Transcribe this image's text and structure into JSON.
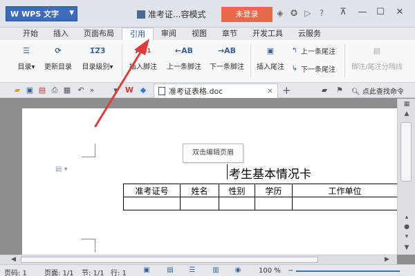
{
  "titlebar": {
    "app_logo": "W",
    "app_name": "WPS 文字",
    "doc_title": "准考证...容模式",
    "login": "未登录",
    "icons": [
      "skin-icon",
      "settings-icon",
      "share-icon",
      "help-icon"
    ],
    "help_glyph": "?",
    "restore_glyph": "⊼",
    "minimize_glyph": "—",
    "maximize_glyph": "☐",
    "close_glyph": "✕"
  },
  "tabs": [
    {
      "label": "开始"
    },
    {
      "label": "插入"
    },
    {
      "label": "页面布局"
    },
    {
      "label": "引用",
      "active": true
    },
    {
      "label": "审阅"
    },
    {
      "label": "视图"
    },
    {
      "label": "章节"
    },
    {
      "label": "开发工具"
    },
    {
      "label": "云服务"
    }
  ],
  "ribbon": {
    "toc": "目录",
    "update_toc": "更新目录",
    "toc_level": "目录级别",
    "insert_footnote": "插入脚注",
    "prev_footnote": "上一条脚注",
    "next_footnote": "下一条脚注",
    "insert_endnote": "插入尾注",
    "prev_endnote": "上一条尾注",
    "next_endnote": "下一条尾注",
    "separator_line": "脚注/尾注分隔线",
    "ab_glyph": "AB",
    "sup_1": "1"
  },
  "quickbar": {
    "doc_tab": "准考证表格.doc",
    "close_glyph": "×",
    "plus_glyph": "+",
    "search_cmd": "点此查找命令"
  },
  "document": {
    "header_hint": "双击编辑页眉",
    "heading": "考生基本情况卡",
    "table_headers": [
      "准考证号",
      "姓名",
      "性别",
      "学历",
      "工作单位"
    ],
    "table_row": [
      "",
      "",
      "",
      "",
      ""
    ]
  },
  "statusbar": {
    "page_num": "页码: 1",
    "pages": "页面: 1/1",
    "section": "节: 1/1",
    "line": "行: 1",
    "zoom": "100 %",
    "zoom_minus": "−"
  },
  "colors": {
    "accent": "#3d6dba",
    "login_bg": "#e8694a",
    "annotation": "#e03a3a"
  }
}
